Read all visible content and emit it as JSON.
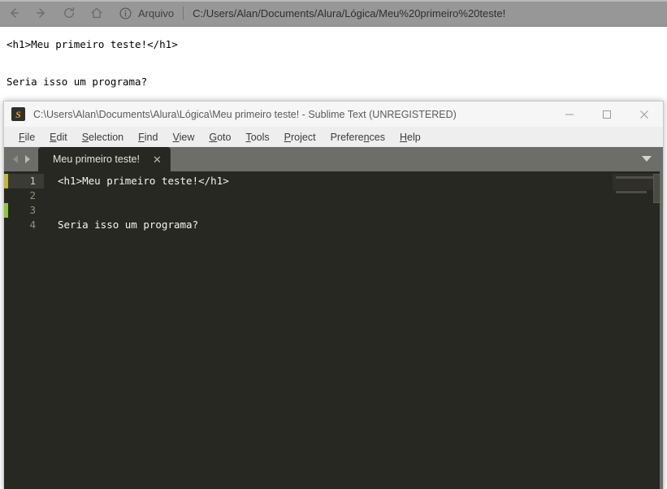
{
  "browser": {
    "toolbar": {
      "back_icon": "arrow-left-icon",
      "forward_icon": "arrow-right-icon",
      "reload_icon": "reload-icon",
      "home_icon": "home-icon",
      "info_icon": "info-circle-icon",
      "origin_label": "Arquivo",
      "url": "C:/Users/Alan/Documents/Alura/Lógica/Meu%20primeiro%20teste!"
    },
    "page": {
      "line1": "<h1>Meu primeiro teste!</h1>",
      "line2": "Seria isso um programa?"
    }
  },
  "sublime": {
    "titlebar": {
      "logo_letter": "S",
      "title": "C:\\Users\\Alan\\Documents\\Alura\\Lógica\\Meu primeiro teste! - Sublime Text (UNREGISTERED)",
      "minimize_label": "—",
      "maximize_label": "□",
      "close_label": "✕"
    },
    "menubar": {
      "items": [
        {
          "pre": "",
          "mnemonic": "F",
          "post": "ile"
        },
        {
          "pre": "",
          "mnemonic": "E",
          "post": "dit"
        },
        {
          "pre": "",
          "mnemonic": "S",
          "post": "election"
        },
        {
          "pre": "",
          "mnemonic": "F",
          "post": "ind"
        },
        {
          "pre": "",
          "mnemonic": "V",
          "post": "iew"
        },
        {
          "pre": "",
          "mnemonic": "G",
          "post": "oto"
        },
        {
          "pre": "",
          "mnemonic": "T",
          "post": "ools"
        },
        {
          "pre": "",
          "mnemonic": "P",
          "post": "roject"
        },
        {
          "pre": "Prefere",
          "mnemonic": "n",
          "post": "ces"
        },
        {
          "pre": "",
          "mnemonic": "H",
          "post": "elp"
        }
      ]
    },
    "tabbar": {
      "nav_prev_icon": "caret-left-icon",
      "nav_next_icon": "caret-right-icon",
      "tab_label": "Meu primeiro teste!",
      "tab_close_label": "✕",
      "dropdown_icon": "caret-down-icon"
    },
    "editor": {
      "lines": [
        {
          "number": "1",
          "text": "<h1>Meu primeiro teste!</h1>",
          "marker": "yellow",
          "active": true
        },
        {
          "number": "2",
          "text": "",
          "marker": "none",
          "active": false
        },
        {
          "number": "3",
          "text": "",
          "marker": "green",
          "active": false
        },
        {
          "number": "4",
          "text": "Seria isso um programa?",
          "marker": "none",
          "active": false
        }
      ]
    },
    "colors": {
      "editor_background": "#272822",
      "tabbar_background": "#6d6e69",
      "titlebar_background": "#f6f6f6",
      "menubar_background": "#eeeeee",
      "marker_yellow": "#c3b63a",
      "marker_green": "#8fc53f",
      "code_text": "#f6f6ef",
      "gutter_text": "#90917f",
      "logo_orange": "#f89d21"
    }
  }
}
